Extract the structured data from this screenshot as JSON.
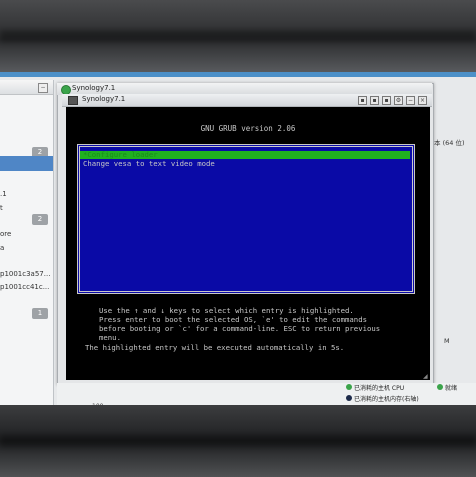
{
  "vm": {
    "tab_title": "Synology7.1",
    "window_title": "Synology7.1"
  },
  "grub": {
    "version_line": "GNU GRUB  version 2.06",
    "entries": [
      "*Configure loader",
      "Change vesa to text video mode"
    ],
    "help_lines": [
      "Use the ↑ and ↓ keys to select which entry is highlighted.",
      "Press enter to boot the selected OS, `e' to edit the commands",
      "before booting or `c' for a command-line. ESC to return previous",
      "menu.",
      "The highlighted entry will be executed automatically in 5s."
    ]
  },
  "left_panel": {
    "items": [
      {
        "label": ".1"
      },
      {
        "label": "t"
      },
      {
        "label": "ore"
      },
      {
        "label": "a"
      },
      {
        "label": "p1001c3a57..."
      },
      {
        "label": "p1001cc41c..."
      }
    ],
    "badges": [
      "2",
      "2",
      "1"
    ]
  },
  "right_info": {
    "line1": "本 (64 位)",
    "line2": "M"
  },
  "legend": {
    "cpu": "已消耗的主机 CPU",
    "mem": "已消耗的主机内存(右轴)",
    "ready": "就绪",
    "axis_value": "100"
  },
  "colors": {
    "grub_bg": "#0a0aa6",
    "grub_highlight": "#20b020",
    "cpu_legend": "#3aa34a",
    "mem_legend": "#1c2a4a",
    "ready_legend": "#3aa34a"
  }
}
